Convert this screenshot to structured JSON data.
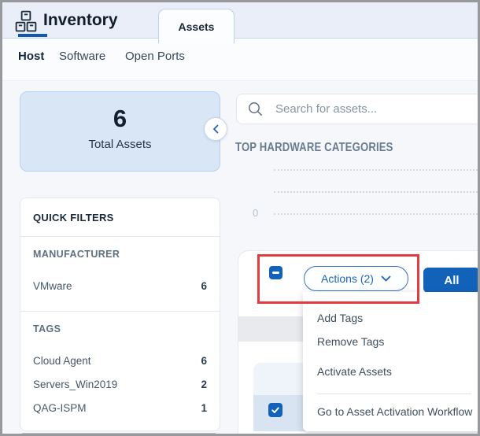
{
  "app": {
    "title": "Inventory",
    "active_tab": "Assets"
  },
  "nav": {
    "items": [
      "Host",
      "Software",
      "Open Ports"
    ],
    "active": "Host"
  },
  "summary_card": {
    "count": "6",
    "label": "Total Assets"
  },
  "quick_filters": {
    "title": "QUICK FILTERS",
    "groups": [
      {
        "title": "MANUFACTURER",
        "items": [
          {
            "label": "VMware",
            "count": "6"
          }
        ]
      },
      {
        "title": "TAGS",
        "items": [
          {
            "label": "Cloud Agent",
            "count": "6"
          },
          {
            "label": "Servers_Win2019",
            "count": "2"
          },
          {
            "label": "QAG-ISPM",
            "count": "1"
          }
        ]
      }
    ]
  },
  "search": {
    "placeholder": "Search for assets...",
    "value": ""
  },
  "hardware_chart": {
    "title": "TOP HARDWARE CATEGORIES",
    "y_tick": "0"
  },
  "toolbar": {
    "actions_label": "Actions (2)",
    "all_label": "All"
  },
  "actions_menu": {
    "items": [
      "Add Tags",
      "Remove Tags",
      "Activate Assets",
      "Go to Asset Activation Workflow"
    ]
  },
  "selection": {
    "header_checkbox": "indeterminate",
    "row_checkbox": "checked"
  },
  "colors": {
    "accent_blue": "#1362ba",
    "highlight_red": "#e23b40",
    "summary_card_bg": "#d9e6f6"
  }
}
